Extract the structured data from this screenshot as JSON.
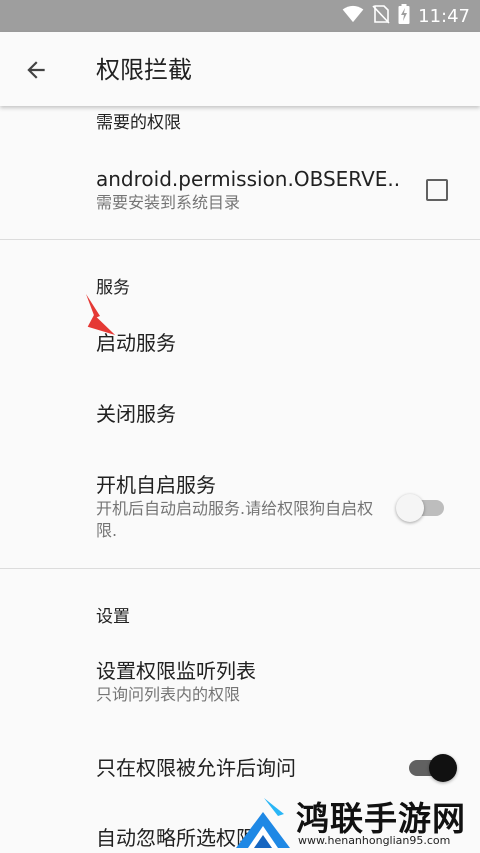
{
  "status_bar": {
    "time": "11:47",
    "icons": [
      "wifi-icon",
      "no-sim-icon",
      "battery-charging-icon"
    ]
  },
  "app_bar": {
    "title": "权限拦截",
    "back_icon": "arrow-back-icon"
  },
  "sections": {
    "permissions": {
      "header": "需要的权限",
      "item": {
        "title": "android.permission.OBSERVE..",
        "summary": "需要安装到系统目录",
        "checked": false
      }
    },
    "service": {
      "header": "服务",
      "start": "启动服务",
      "stop": "关闭服务",
      "boot": {
        "title": "开机自启服务",
        "summary": "开机后自动启动服务.请给权限狗自启权限.",
        "enabled": false
      }
    },
    "settings": {
      "header": "设置",
      "listen_list": {
        "title": "设置权限监听列表",
        "summary": "只询问列表内的权限"
      },
      "ask_after_allow": {
        "title": "只在权限被允许后询问",
        "enabled": true
      },
      "auto_ignore": {
        "title": "自动忽略所选权限"
      }
    }
  },
  "colors": {
    "status_bar": "#9e9e9e",
    "background": "#fafafa",
    "switch_on": "#111111",
    "annotation_arrow": "#e53935"
  },
  "watermark": {
    "title": "鸿联手游网",
    "url": "www.henanhonglian95.com"
  }
}
